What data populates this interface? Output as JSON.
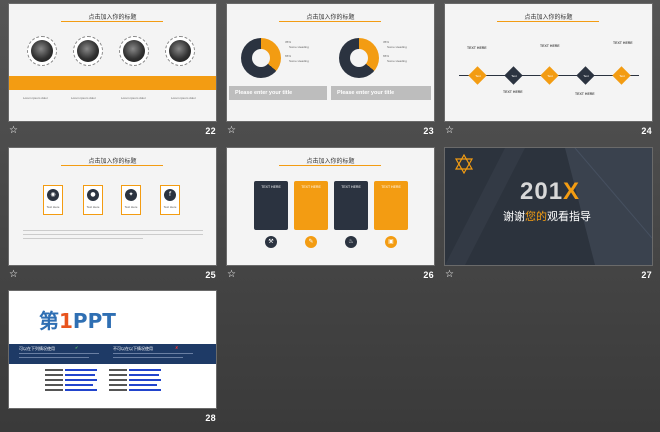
{
  "slides": [
    {
      "number": "22",
      "title": "点击加入你的标题",
      "labels": [
        "Lorem ipsum dolor",
        "Lorem ipsum dolor",
        "Lorem ipsum dolor",
        "Lorem ipsum dolor"
      ]
    },
    {
      "number": "23",
      "title": "点击加入你的标题",
      "legend_items": [
        "Some Heading",
        "Some Heading"
      ],
      "percents": [
        "35%",
        "65%"
      ],
      "banner": "Please enter your title"
    },
    {
      "number": "24",
      "title": "点击加入你的标题",
      "top_labels": [
        "TEXT HERE",
        "TEXT HERE",
        "TEXT HERE"
      ],
      "bottom_labels": [
        "TEXT HERE",
        "TEXT HERE"
      ],
      "diamond_text": "Text"
    },
    {
      "number": "25",
      "title": "点击加入你的标题",
      "icon_label": "Text Here",
      "icons": [
        "weibo",
        "wechat",
        "twitter",
        "facebook"
      ]
    },
    {
      "number": "26",
      "title": "点击加入你的标题",
      "card_title": "TEXT HERE"
    },
    {
      "number": "27",
      "headline_prefix": "201",
      "headline_accent": "X",
      "thanks_a": "谢谢",
      "thanks_b": "您的",
      "thanks_c": "观看",
      "thanks_d": "指导"
    },
    {
      "number": "28",
      "logo_a": "第",
      "logo_b": "1",
      "logo_c": "PPT",
      "left_heading": "可以在下列情况使用",
      "right_heading": "不可以在以下情况使用"
    }
  ],
  "colors": {
    "accent": "#f39c12",
    "dark": "#2b3340"
  },
  "icon_names": {
    "star": "star-icon"
  }
}
